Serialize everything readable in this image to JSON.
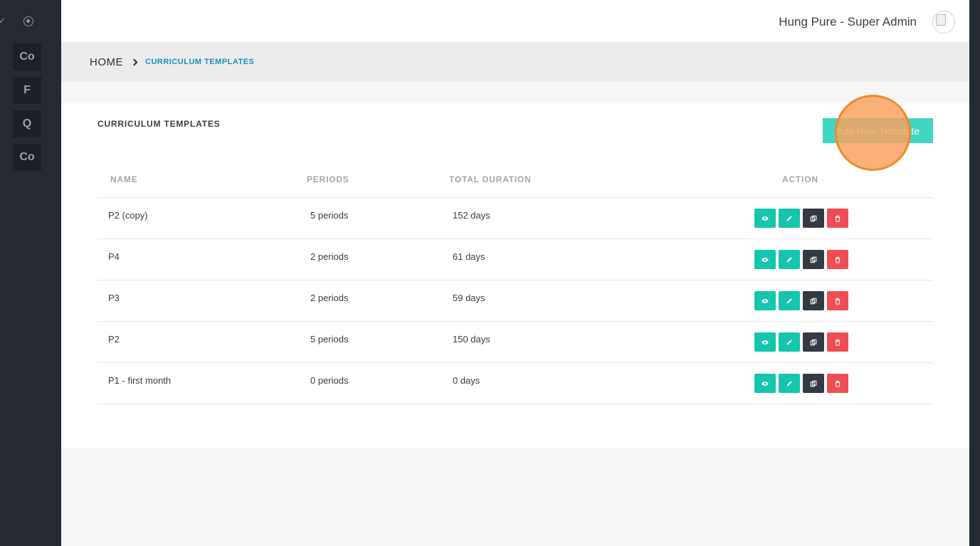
{
  "sidebar": {
    "items": [
      {
        "label": "Co"
      },
      {
        "label": "F"
      },
      {
        "label": "Q"
      },
      {
        "label": "Co"
      }
    ]
  },
  "header": {
    "user_name": "Hung Pure - Super Admin"
  },
  "breadcrumb": {
    "home": "HOME",
    "current": "CURRICULUM TEMPLATES"
  },
  "main": {
    "title": "CURRICULUM TEMPLATES",
    "add_button_label": "Add New Template",
    "table": {
      "columns": [
        "NAME",
        "PERIODS",
        "TOTAL DURATION",
        "ACTION"
      ],
      "rows": [
        {
          "name": "P2 (copy)",
          "periods": "5 periods",
          "duration": "152 days"
        },
        {
          "name": "P4",
          "periods": "2 periods",
          "duration": "61 days"
        },
        {
          "name": "P3",
          "periods": "2 periods",
          "duration": "59 days"
        },
        {
          "name": "P2",
          "periods": "5 periods",
          "duration": "150 days"
        },
        {
          "name": "P1 - first month",
          "periods": "0 periods",
          "duration": "0 days"
        }
      ]
    }
  },
  "colors": {
    "sidebar": "#252a33",
    "accent": "#15c5ad",
    "danger": "#ef4d55",
    "dark": "#343a42",
    "link": "#1a8fc2"
  },
  "icons": [
    "check-icon",
    "settings-icon",
    "eye-icon",
    "pencil-icon",
    "copy-icon",
    "trash-icon"
  ]
}
